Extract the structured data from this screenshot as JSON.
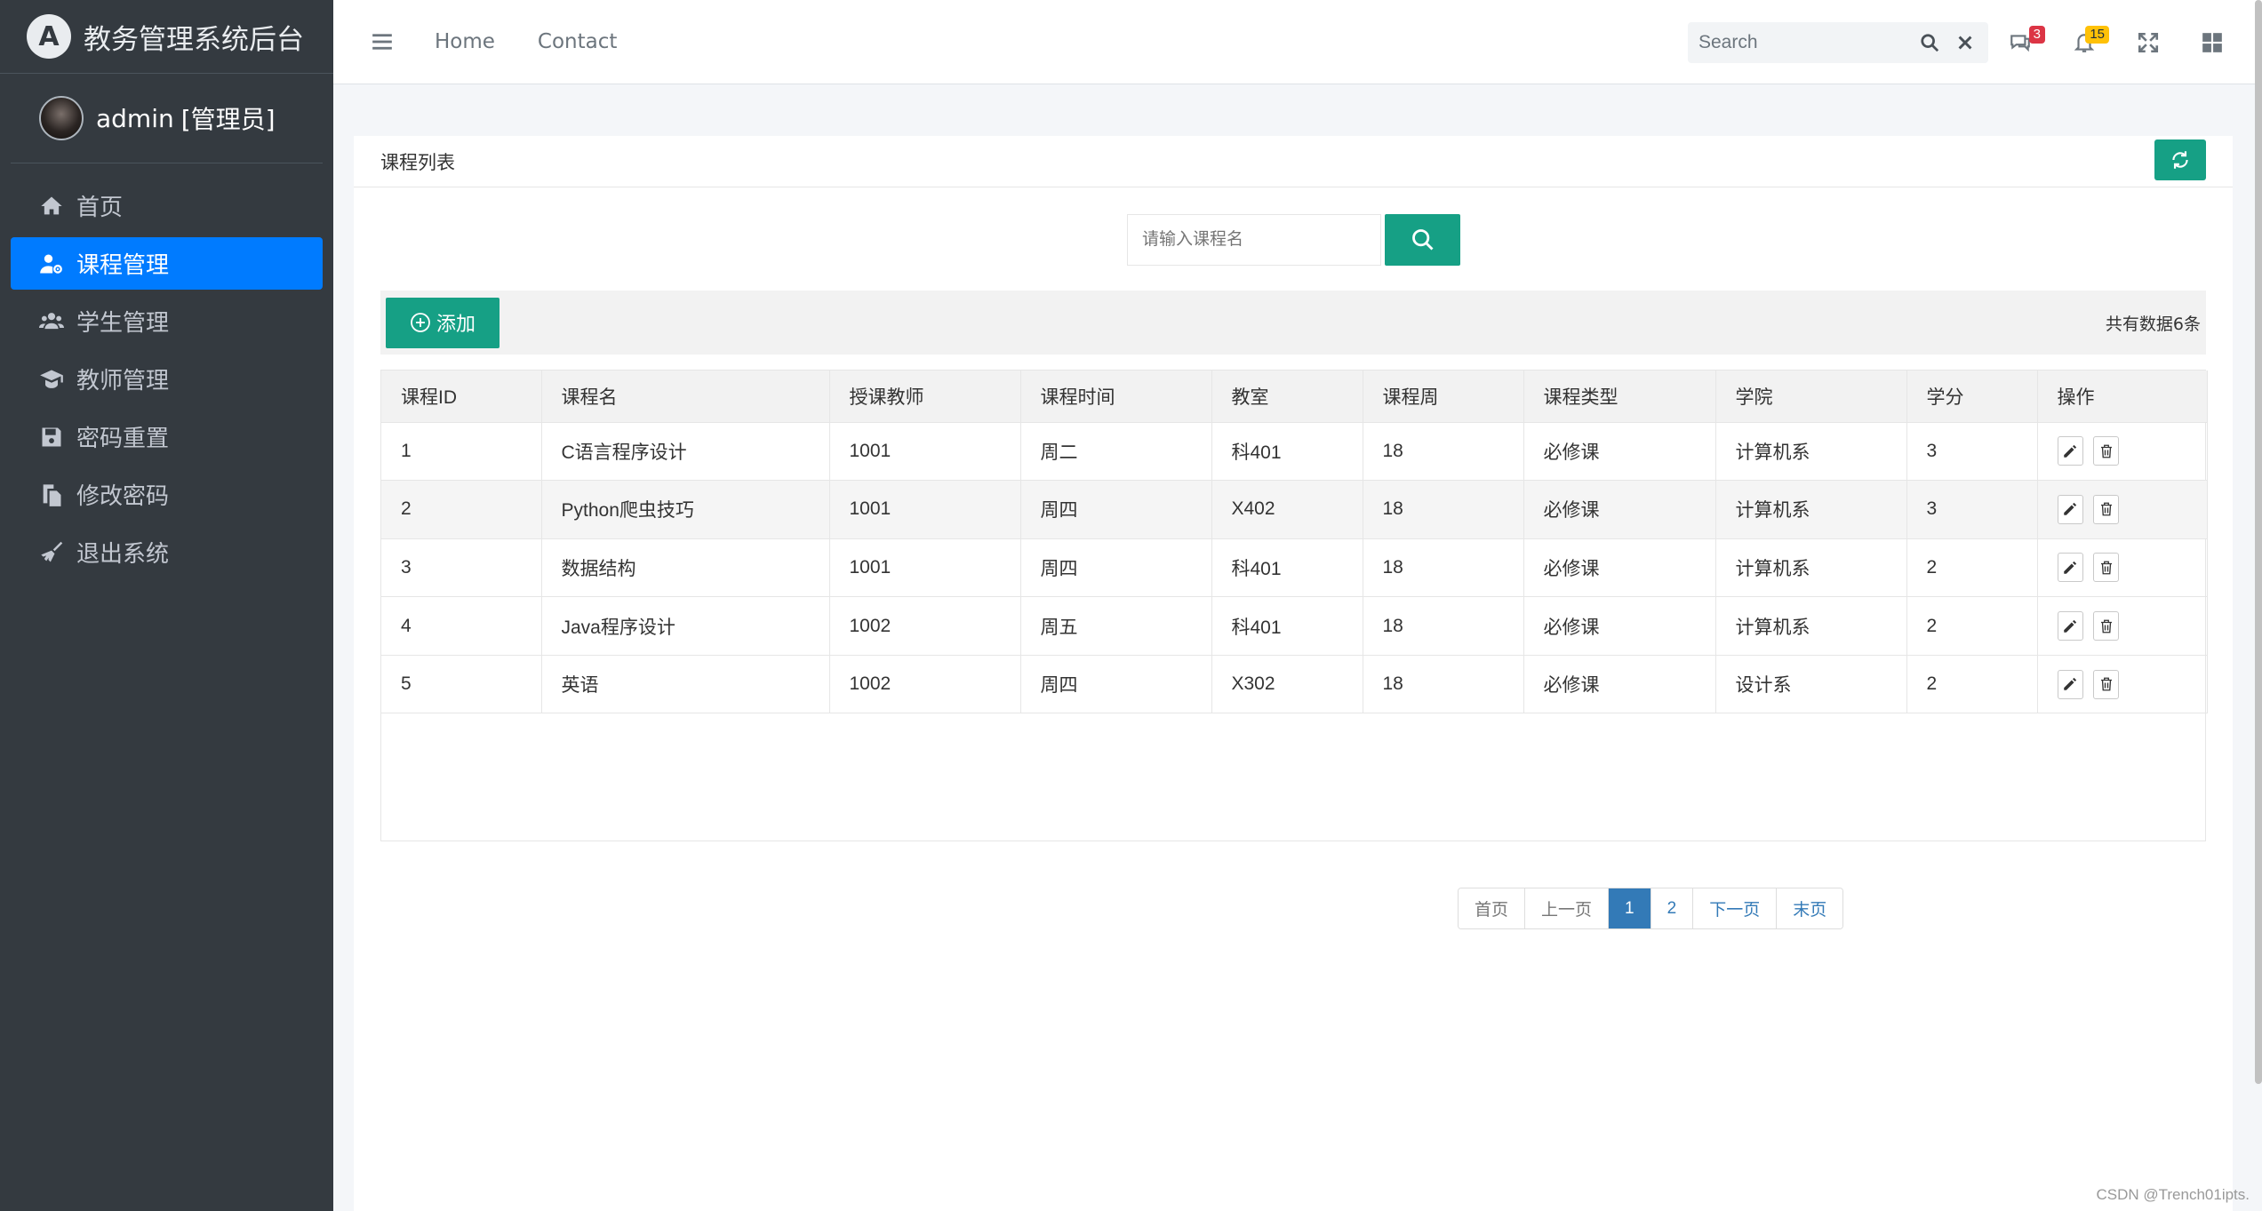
{
  "brand": {
    "logo_letter": "A",
    "title": "教务管理系统后台"
  },
  "user": {
    "name": "admin",
    "role": "[管理员]"
  },
  "sidebar": {
    "items": [
      {
        "label": "首页",
        "icon": "home-icon",
        "active": false
      },
      {
        "label": "课程管理",
        "icon": "user-gear-icon",
        "active": true
      },
      {
        "label": "学生管理",
        "icon": "users-icon",
        "active": false
      },
      {
        "label": "教师管理",
        "icon": "graduation-cap-icon",
        "active": false
      },
      {
        "label": "密码重置",
        "icon": "save-icon",
        "active": false
      },
      {
        "label": "修改密码",
        "icon": "copy-icon",
        "active": false
      },
      {
        "label": "退出系统",
        "icon": "broom-icon",
        "active": false
      }
    ]
  },
  "topbar": {
    "links": [
      "Home",
      "Contact"
    ],
    "search_placeholder": "Search",
    "messages_badge": "3",
    "notifications_badge": "15"
  },
  "card": {
    "title": "课程列表"
  },
  "search": {
    "placeholder": "请输入课程名"
  },
  "toolbar": {
    "add_label": "添加",
    "total_text": "共有数据6条"
  },
  "table": {
    "headers": [
      "课程ID",
      "课程名",
      "授课教师",
      "课程时间",
      "教室",
      "课程周",
      "课程类型",
      "学院",
      "学分",
      "操作"
    ],
    "rows": [
      [
        "1",
        "C语言程序设计",
        "1001",
        "周二",
        "科401",
        "18",
        "必修课",
        "计算机系",
        "3"
      ],
      [
        "2",
        "Python爬虫技巧",
        "1001",
        "周四",
        "X402",
        "18",
        "必修课",
        "计算机系",
        "3"
      ],
      [
        "3",
        "数据结构",
        "1001",
        "周四",
        "科401",
        "18",
        "必修课",
        "计算机系",
        "2"
      ],
      [
        "4",
        "Java程序设计",
        "1002",
        "周五",
        "科401",
        "18",
        "必修课",
        "计算机系",
        "2"
      ],
      [
        "5",
        "英语",
        "1002",
        "周四",
        "X302",
        "18",
        "必修课",
        "设计系",
        "2"
      ]
    ]
  },
  "pagination": {
    "first": "首页",
    "prev": "上一页",
    "pages": [
      "1",
      "2"
    ],
    "current": "1",
    "next": "下一页",
    "last": "末页"
  },
  "watermark": "CSDN @Trench01ipts.",
  "colors": {
    "accent": "#16a085",
    "active_nav": "#007bff",
    "sidebar_bg": "#343a40",
    "page_link": "#337ab7"
  }
}
